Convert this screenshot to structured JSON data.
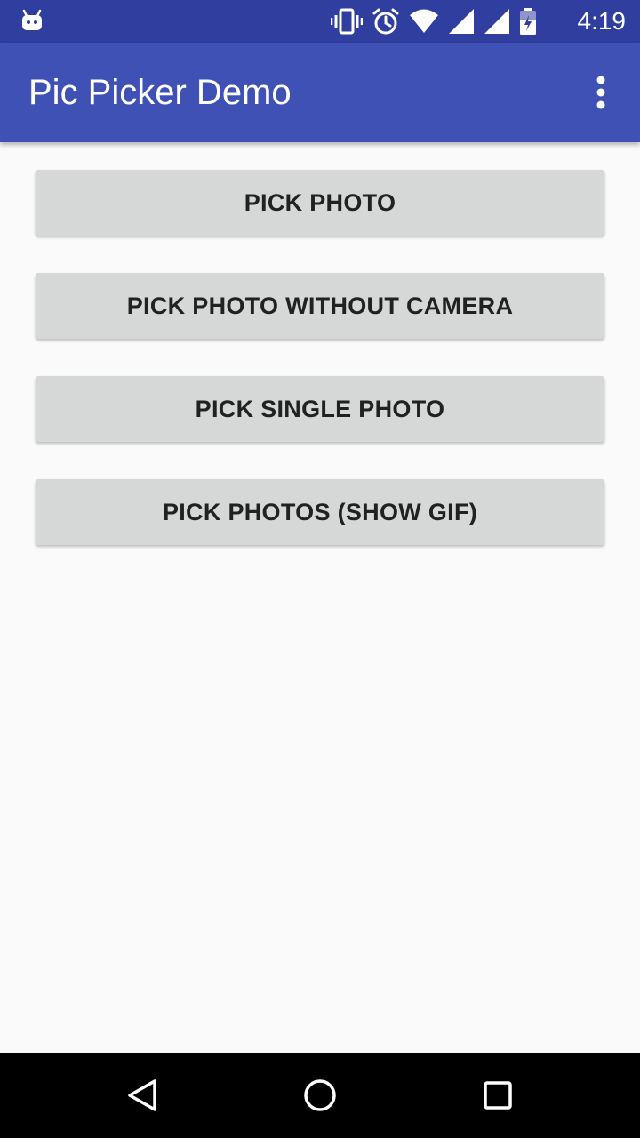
{
  "status_bar": {
    "time": "4:19",
    "icons": [
      "android-notification-icon",
      "vibrate-icon",
      "alarm-icon",
      "wifi-icon",
      "signal-icon",
      "signal-icon-2",
      "battery-icon"
    ]
  },
  "app_bar": {
    "title": "Pic Picker Demo",
    "overflow_icon": "more-vert-icon"
  },
  "buttons": [
    {
      "label": "PICK PHOTO"
    },
    {
      "label": "PICK PHOTO WITHOUT CAMERA"
    },
    {
      "label": "PICK SINGLE PHOTO"
    },
    {
      "label": "PICK PHOTOS (SHOW GIF)"
    }
  ],
  "nav_bar": {
    "icons": [
      "back-icon",
      "home-icon",
      "recents-icon"
    ]
  },
  "colors": {
    "status_bar": "#303f9f",
    "app_bar": "#3f51b5",
    "background": "#fafafa",
    "button": "#d6d7d7",
    "button_text": "#212121",
    "nav_bar": "#000000"
  }
}
